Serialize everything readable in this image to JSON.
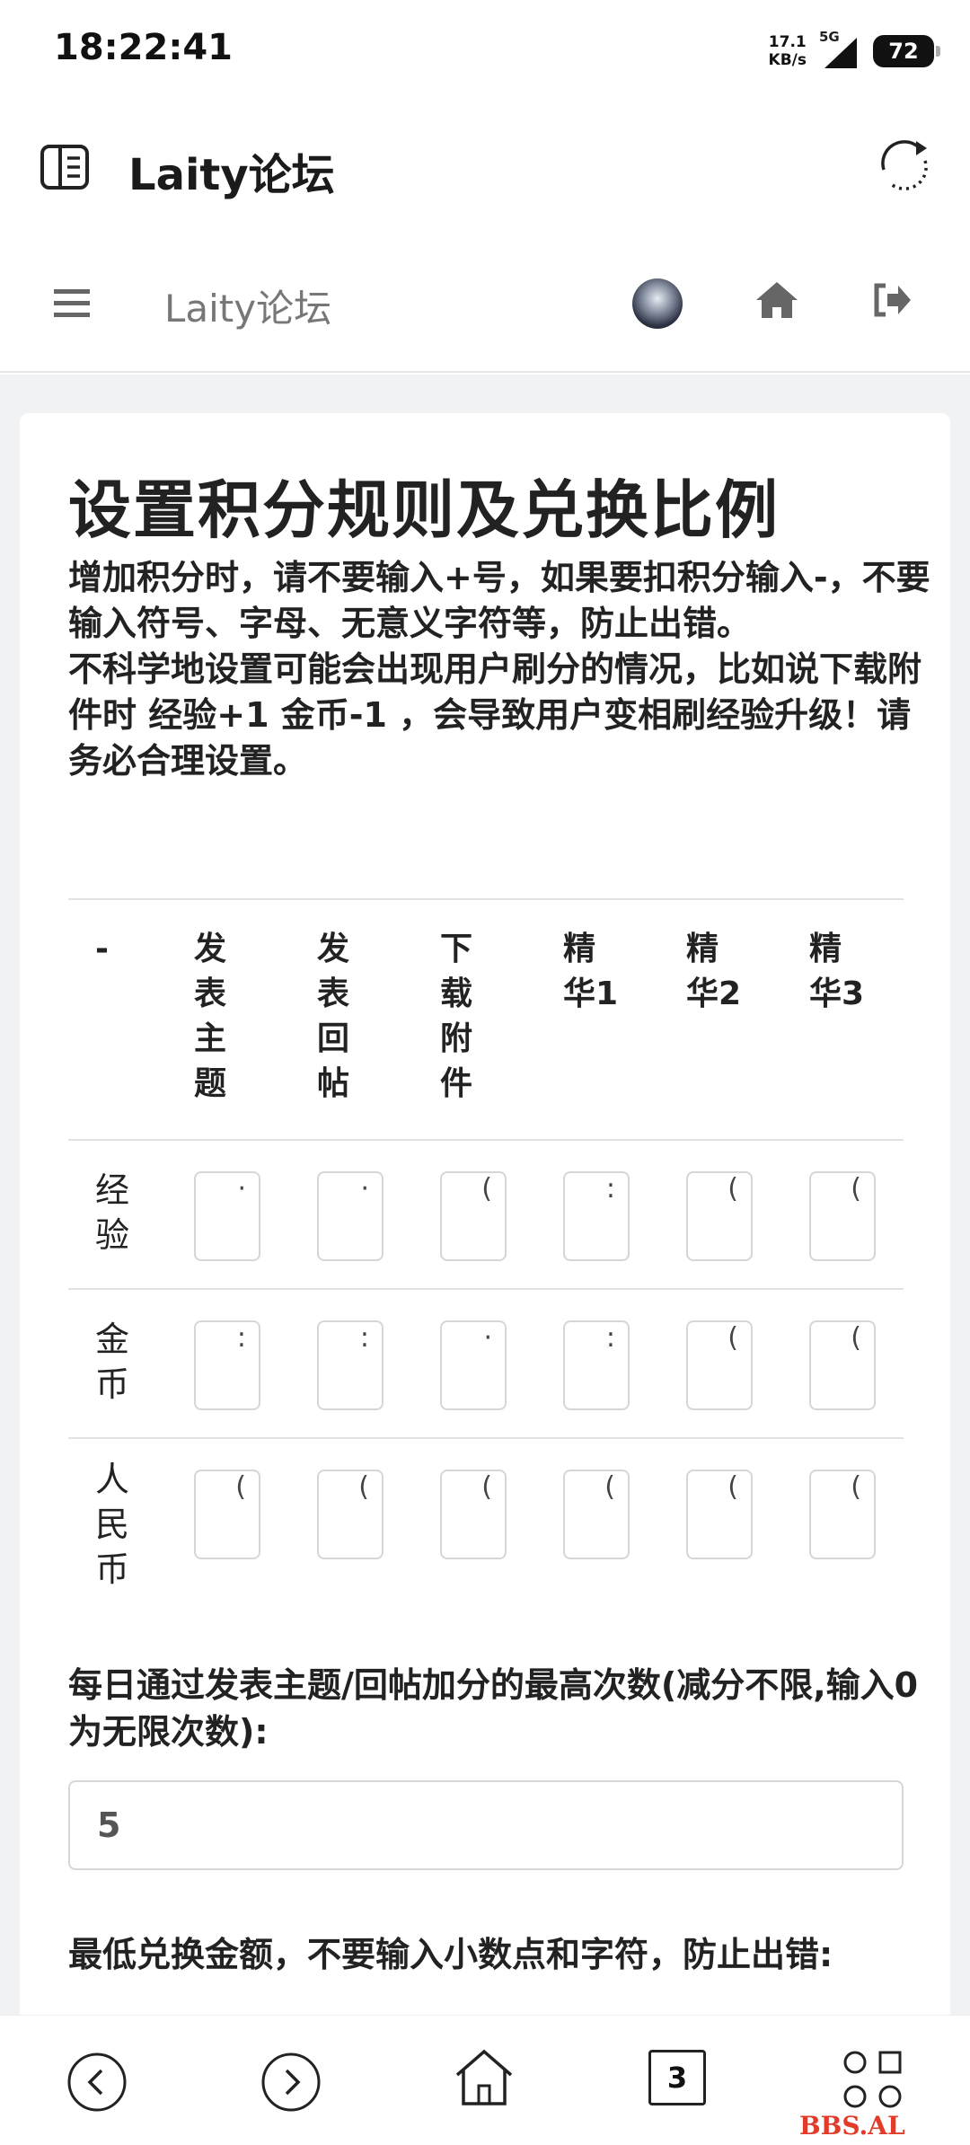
{
  "status": {
    "time": "18:22:41",
    "net_speed_value": "17.1",
    "net_speed_unit": "KB/s",
    "network": "5G",
    "battery": "72"
  },
  "app_bar": {
    "title": "Laity论坛"
  },
  "site_nav": {
    "title": "Laity论坛"
  },
  "card": {
    "title": "设置积分规则及兑换比例",
    "desc_1": "增加积分时，请不要输入+号，如果要扣积分输入-，不要输入符号、字母、无意义字符等，防止出错。",
    "desc_2": "不科学地设置可能会出现用户刷分的情况，比如说下载附件时 经验+1 金币-1 ，会导致用户变相刷经验升级！请务必合理设置。"
  },
  "table": {
    "corner": "-",
    "columns": [
      "发表主题",
      "发表回帖",
      "下载附件",
      "精华1",
      "精华2",
      "精华3"
    ],
    "rows": [
      {
        "label": "经验",
        "values": [
          "·",
          "·",
          "(",
          ":",
          "(",
          "("
        ]
      },
      {
        "label": "金币",
        "values": [
          ":",
          ":",
          "·",
          ":",
          "(",
          "("
        ]
      },
      {
        "label": "人民币",
        "values": [
          "(",
          "(",
          "(",
          "(",
          "(",
          "("
        ]
      }
    ]
  },
  "daily_limit": {
    "label": "每日通过发表主题/回帖加分的最高次数(减分不限,输入0为无限次数):",
    "value": "5"
  },
  "min_exchange": {
    "label": "最低兑换金额，不要输入小数点和字符，防止出错:"
  },
  "bottom_bar": {
    "tabs_count": "3"
  },
  "watermark": "BBS.AL",
  "colors": {
    "page_bg": "#f1f2f4",
    "card_bg": "#ffffff",
    "border": "#d6d6d6",
    "brand_red": "#e23b2a"
  }
}
